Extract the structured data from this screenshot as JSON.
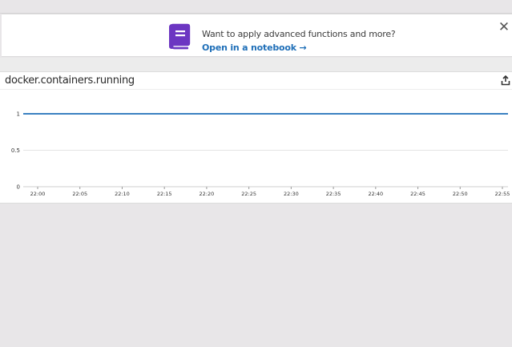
{
  "banner": {
    "message": "Want to apply advanced functions and more?",
    "link": "Open in a notebook →",
    "close": "✕",
    "icon": "notebook-book-icon",
    "icon_color": "#6c36c2"
  },
  "panel": {
    "title": "docker.containers.running",
    "export_icon": "export-icon"
  },
  "chart_data": {
    "type": "line",
    "title": "docker.containers.running",
    "xlabel": "",
    "ylabel": "",
    "x_ticks": [
      "22:00",
      "22:05",
      "22:10",
      "22:15",
      "22:20",
      "22:25",
      "22:30",
      "22:35",
      "22:40",
      "22:45",
      "22:50",
      "22:55"
    ],
    "y_ticks": [
      "0",
      "0.5",
      "1"
    ],
    "ylim": [
      0,
      1
    ],
    "series": [
      {
        "color": "#1f6fb8",
        "x": [
          "21:58",
          "22:55"
        ],
        "values": [
          1,
          1
        ]
      }
    ],
    "grid": true
  }
}
